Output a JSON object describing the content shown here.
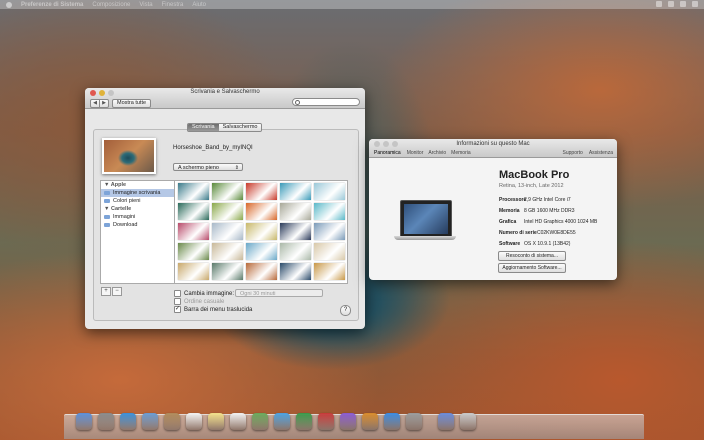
{
  "menubar": {
    "app": "Preferenze di Sistema",
    "items": [
      "Composizione",
      "Vista",
      "Finestra",
      "Aiuto"
    ]
  },
  "desktop_window": {
    "title": "Scrivania e Salvaschermo",
    "show_all": "Mostra tutte",
    "search_placeholder": "",
    "tabs": [
      "Scrivania",
      "Salvaschermo"
    ],
    "image_name": "Horseshoe_Band_by_myINQI",
    "fit_option": "A schermo pieno",
    "sources": {
      "apple_group": "Apple",
      "apple_items": [
        "Immagine scrivania",
        "Colori pieni"
      ],
      "folders_group": "Cartelle",
      "folder_items": [
        "Immagini",
        "Download"
      ]
    },
    "add_label": "+",
    "remove_label": "−",
    "change_picture": "Cambia immagine:",
    "interval": "Ogni 30 minuti",
    "random_order": "Ordine casuale",
    "translucent_menu": "Barra dei menu traslucida",
    "help": "?"
  },
  "thumbnail_colors": [
    [
      "#3a7a8a",
      "#5a8a3a",
      "#c83a2a",
      "#3a9ab8",
      "#9ac8d8"
    ],
    [
      "#2a6a5a",
      "#8aa84a",
      "#d8682a",
      "#a8a898",
      "#5ab8c8"
    ],
    [
      "#b84a6a",
      "#a8b8c8",
      "#c8b86a",
      "#2a3a5a",
      "#7a9ab8"
    ],
    [
      "#6a8a4a",
      "#c8b898",
      "#6aa8c8",
      "#aab8a8",
      "#d8c8a8"
    ],
    [
      "#c8a86a",
      "#5a7a6a",
      "#b86a3a",
      "#2a4a6a",
      "#c89848"
    ]
  ],
  "about_window": {
    "title": "Informazioni su questo Mac",
    "tabs": [
      "Panoramica",
      "Monitor",
      "Archivio",
      "Memoria"
    ],
    "links": [
      "Supporto",
      "Assistenza"
    ],
    "product": "MacBook Pro",
    "subtitle": "Retina, 13-inch, Late 2012",
    "specs": [
      {
        "k": "Processore",
        "v": "2,9 GHz Intel Core i7"
      },
      {
        "k": "Memoria",
        "v": "8 GB 1600 MHz DDR3"
      },
      {
        "k": "Grafica",
        "v": "Intel HD Graphics 4000 1024 MB"
      },
      {
        "k": "Numero di serie",
        "v": "C02KW0E8DE55"
      },
      {
        "k": "Software",
        "v": "OS X 10.9.1 (13B42)"
      }
    ],
    "report_btn": "Resoconto di sistema...",
    "update_btn": "Aggiornamento Software..."
  },
  "dock_icons": [
    "finder",
    "launchpad",
    "safari",
    "mail",
    "contacts",
    "calendar",
    "notes",
    "reminders",
    "maps",
    "messages",
    "facetime",
    "photo-booth",
    "itunes",
    "ibooks",
    "app-store",
    "system-preferences",
    "downloads",
    "trash"
  ]
}
